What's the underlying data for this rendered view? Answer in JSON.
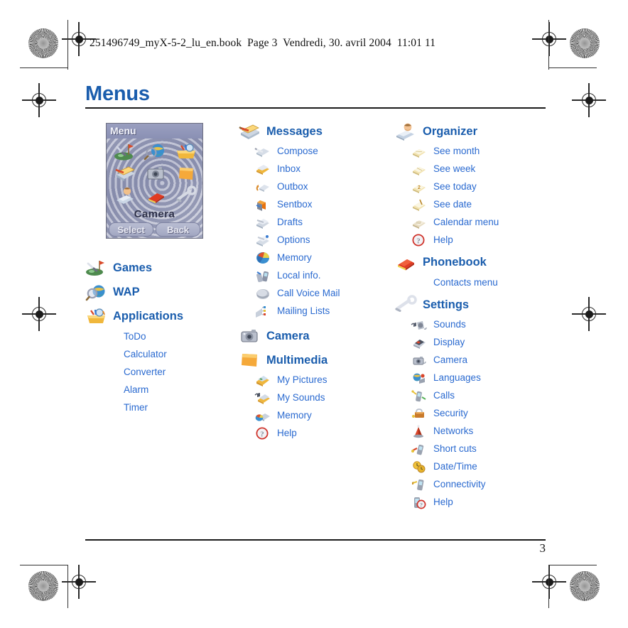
{
  "running_head": "251496749_myX-5-2_lu_en.book  Page 3  Vendredi, 30. avril 2004  11:01 11",
  "page_title": "Menus",
  "folio": "3",
  "colors": {
    "heading_blue": "#1a5dad",
    "item_blue": "#2a6ad0",
    "rule_black": "#1b1b1b",
    "phone_bg": "#9095b4"
  },
  "phone_preview": {
    "title": "Menu",
    "selected_label": "Camera",
    "softkey_left": "Select",
    "softkey_right": "Back",
    "grid_icons": [
      "games-icon",
      "wap-icon",
      "applications-icon",
      "messages-icon",
      "camera-icon",
      "multimedia-icon",
      "organizer-icon",
      "phonebook-icon",
      "settings-icon"
    ]
  },
  "columns": [
    {
      "name": "column-left",
      "groups": [
        {
          "icon": "games-icon",
          "label": "Games",
          "items": []
        },
        {
          "icon": "wap-icon",
          "label": "WAP",
          "items": []
        },
        {
          "icon": "applications-icon",
          "label": "Applications",
          "items": [
            {
              "icon": null,
              "label": "ToDo"
            },
            {
              "icon": null,
              "label": "Calculator"
            },
            {
              "icon": null,
              "label": "Converter"
            },
            {
              "icon": null,
              "label": "Alarm"
            },
            {
              "icon": null,
              "label": "Timer"
            }
          ]
        }
      ]
    },
    {
      "name": "column-middle",
      "groups": [
        {
          "icon": "messages-icon",
          "label": "Messages",
          "items": [
            {
              "icon": "compose-icon",
              "label": "Compose"
            },
            {
              "icon": "inbox-icon",
              "label": "Inbox"
            },
            {
              "icon": "outbox-icon",
              "label": "Outbox"
            },
            {
              "icon": "sentbox-icon",
              "label": "Sentbox"
            },
            {
              "icon": "drafts-icon",
              "label": "Drafts"
            },
            {
              "icon": "options-icon",
              "label": "Options"
            },
            {
              "icon": "memory-icon",
              "label": "Memory"
            },
            {
              "icon": "local-info-icon",
              "label": "Local info."
            },
            {
              "icon": "voicemail-icon",
              "label": "Call Voice Mail"
            },
            {
              "icon": "mailing-lists-icon",
              "label": "Mailing Lists"
            }
          ]
        },
        {
          "icon": "camera-icon",
          "label": "Camera",
          "items": []
        },
        {
          "icon": "multimedia-icon",
          "label": "Multimedia",
          "items": [
            {
              "icon": "my-pictures-icon",
              "label": "My Pictures"
            },
            {
              "icon": "my-sounds-icon",
              "label": "My Sounds"
            },
            {
              "icon": "memory-icon",
              "label": "Memory"
            },
            {
              "icon": "help-icon",
              "label": "Help"
            }
          ]
        }
      ]
    },
    {
      "name": "column-right",
      "groups": [
        {
          "icon": "organizer-icon",
          "label": "Organizer",
          "items": [
            {
              "icon": "see-month-icon",
              "label": "See month"
            },
            {
              "icon": "see-week-icon",
              "label": "See week"
            },
            {
              "icon": "see-today-icon",
              "label": "See today"
            },
            {
              "icon": "see-date-icon",
              "label": "See date"
            },
            {
              "icon": "calendar-menu-icon",
              "label": "Calendar menu"
            },
            {
              "icon": "help-icon",
              "label": "Help"
            }
          ]
        },
        {
          "icon": "phonebook-icon",
          "label": "Phonebook",
          "items": [
            {
              "icon": null,
              "label": "Contacts menu"
            }
          ]
        },
        {
          "icon": "settings-icon",
          "label": "Settings",
          "items": [
            {
              "icon": "sounds-icon",
              "label": "Sounds"
            },
            {
              "icon": "display-icon",
              "label": "Display"
            },
            {
              "icon": "camera-settings-icon",
              "label": "Camera"
            },
            {
              "icon": "languages-icon",
              "label": "Languages"
            },
            {
              "icon": "calls-icon",
              "label": "Calls"
            },
            {
              "icon": "security-icon",
              "label": "Security"
            },
            {
              "icon": "networks-icon",
              "label": "Networks"
            },
            {
              "icon": "short-cuts-icon",
              "label": "Short cuts"
            },
            {
              "icon": "date-time-icon",
              "label": "Date/Time"
            },
            {
              "icon": "connectivity-icon",
              "label": "Connectivity"
            },
            {
              "icon": "phone-help-icon",
              "label": "Help"
            }
          ]
        }
      ]
    }
  ]
}
